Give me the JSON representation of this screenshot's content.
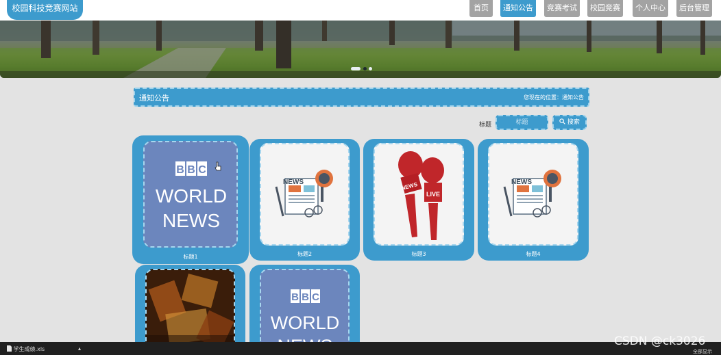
{
  "header": {
    "logo": "校园科技竞赛网站",
    "nav": [
      "首页",
      "通知公告",
      "竞赛考试",
      "校园竞赛",
      "个人中心",
      "后台管理"
    ],
    "active_nav": "通知公告"
  },
  "banner": {
    "slide_count": 3,
    "active_slide": 1
  },
  "breadcrumb": {
    "title": "通知公告",
    "location": "您现在的位置：通知公告"
  },
  "search": {
    "label": "标题",
    "placeholder": "标题",
    "button": "搜索"
  },
  "cards": [
    {
      "caption": "标题1",
      "image": "bbc-world-news"
    },
    {
      "caption": "标题2",
      "image": "news-paper-microphone"
    },
    {
      "caption": "标题3",
      "image": "news-live-microphones"
    },
    {
      "caption": "标题4",
      "image": "news-paper-microphone"
    },
    {
      "caption": "",
      "image": "dark-typography"
    },
    {
      "caption": "",
      "image": "bbc-world-news"
    }
  ],
  "bbc": {
    "letters": [
      "B",
      "B",
      "C"
    ],
    "line1": "WORLD",
    "line2": "NEWS"
  },
  "news_labels": {
    "news": "NEWS",
    "live": "LIVE"
  },
  "taskbar": {
    "download": "学生成绩.xls",
    "show_all": "全部显示"
  },
  "watermark": "CSDN @ck3026",
  "colors": {
    "accent": "#3d9bcd",
    "nav_inactive": "#a3a3a3",
    "page_bg": "#e3e3e3"
  }
}
